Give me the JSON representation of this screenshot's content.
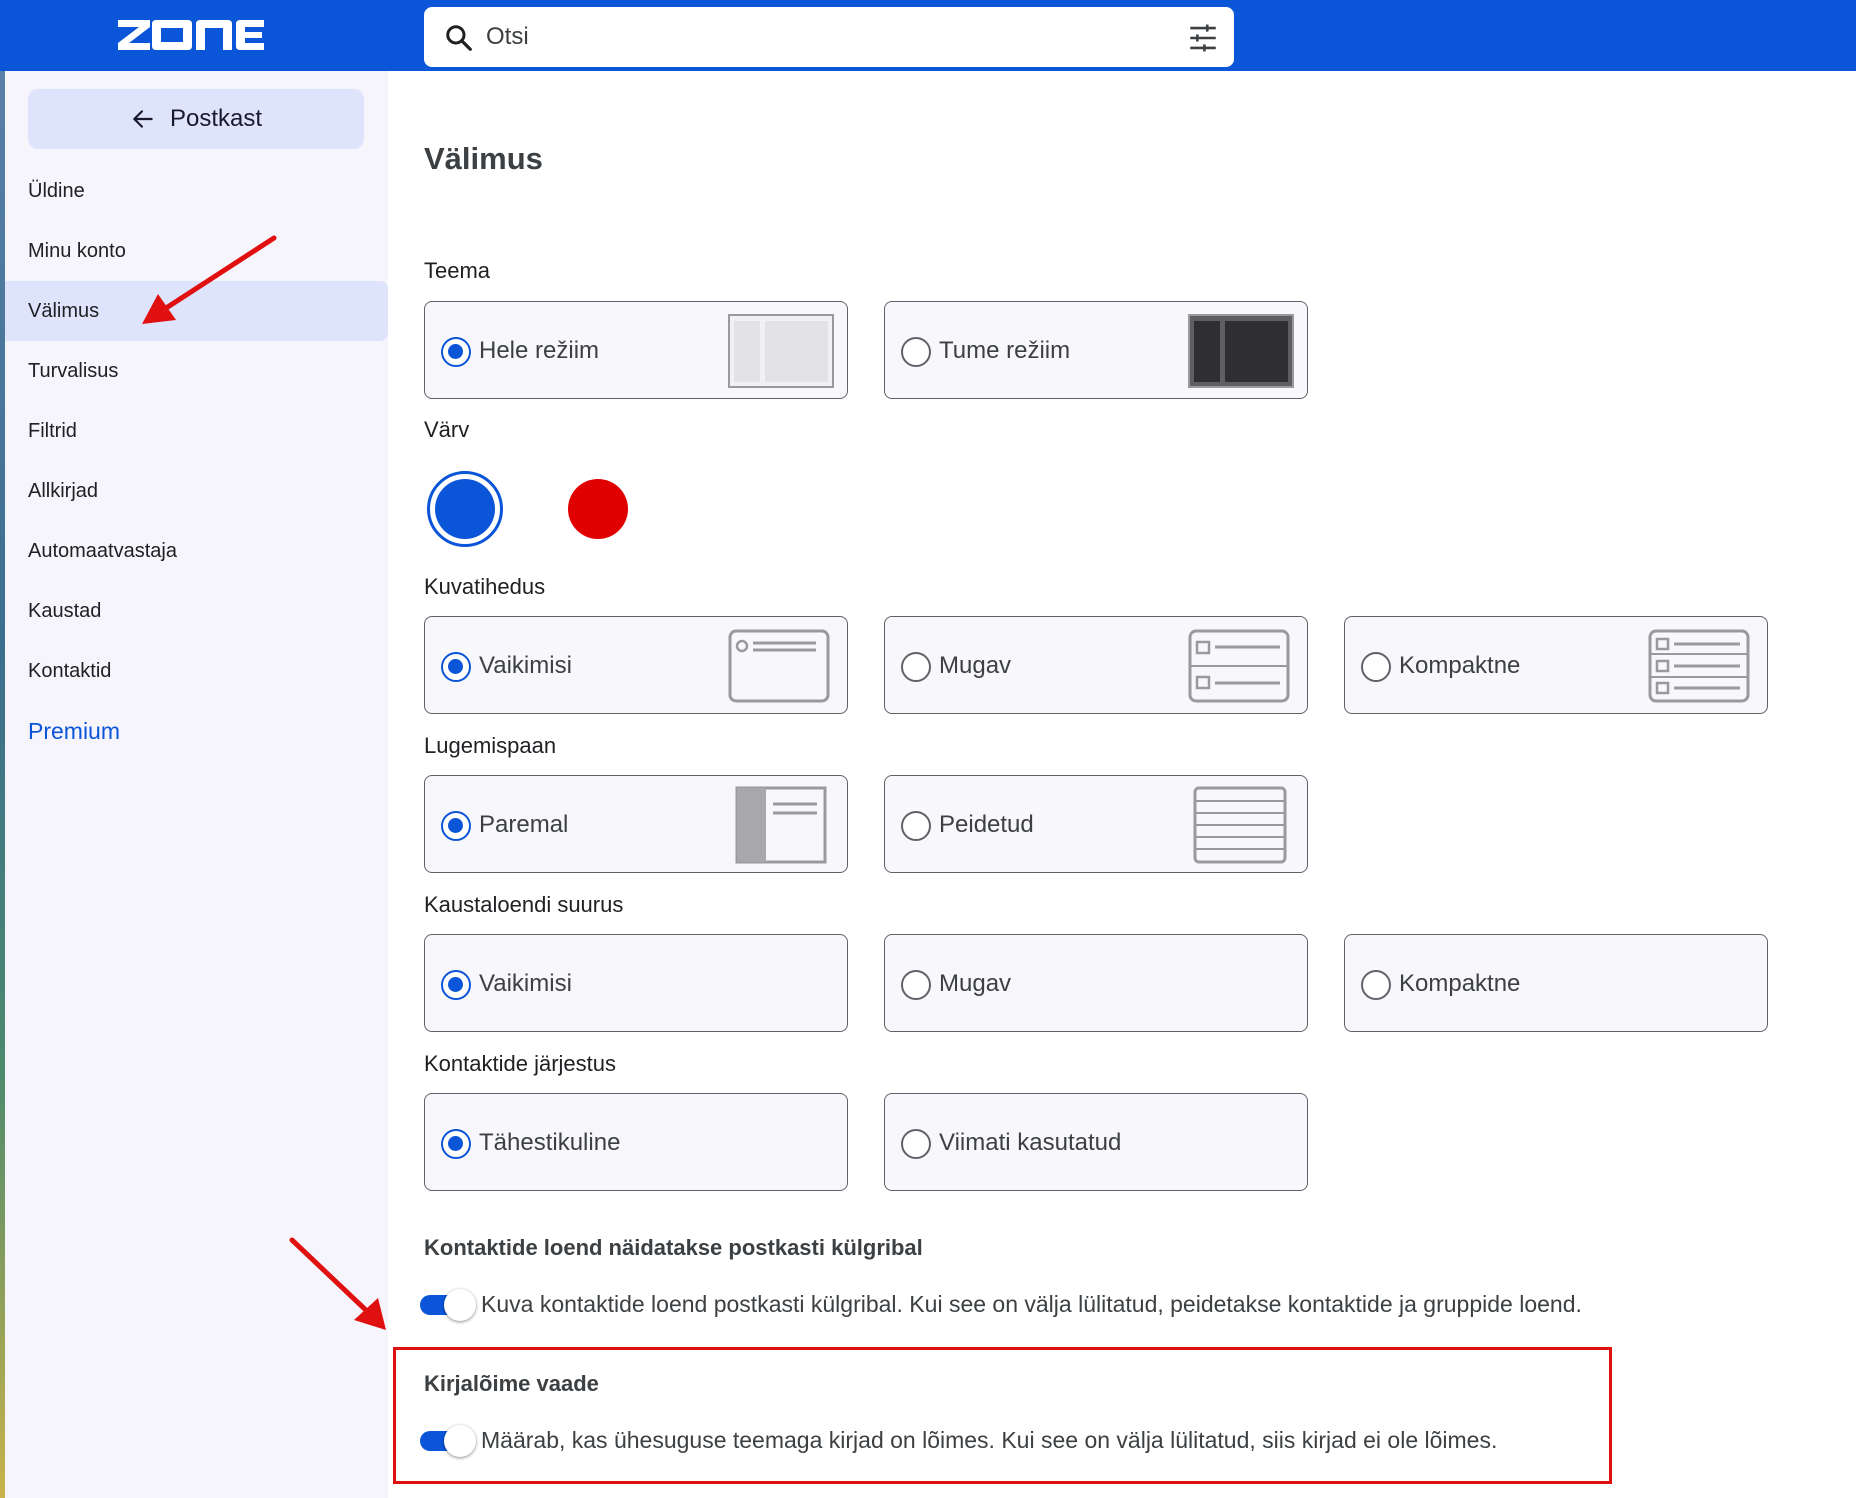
{
  "app": {
    "logo_text": "ZONE",
    "search": {
      "placeholder": "Otsi"
    }
  },
  "sidebar": {
    "back_label": "Postkast",
    "items": [
      {
        "label": "Üldine"
      },
      {
        "label": "Minu konto"
      },
      {
        "label": "Välimus",
        "active": true
      },
      {
        "label": "Turvalisus"
      },
      {
        "label": "Filtrid"
      },
      {
        "label": "Allkirjad"
      },
      {
        "label": "Automaatvastaja"
      },
      {
        "label": "Kaustad"
      },
      {
        "label": "Kontaktid"
      },
      {
        "label": "Premium"
      }
    ]
  },
  "main": {
    "title": "Välimus",
    "theme": {
      "label": "Teema",
      "options": [
        {
          "label": "Hele režiim",
          "checked": true
        },
        {
          "label": "Tume režiim",
          "checked": false
        }
      ]
    },
    "color": {
      "label": "Värv",
      "swatches": [
        {
          "color": "#0b55d8",
          "selected": true
        },
        {
          "color": "#e00000",
          "selected": false
        }
      ]
    },
    "density": {
      "label": "Kuvatihedus",
      "options": [
        {
          "label": "Vaikimisi",
          "checked": true
        },
        {
          "label": "Mugav",
          "checked": false
        },
        {
          "label": "Kompaktne",
          "checked": false
        }
      ]
    },
    "reading_pane": {
      "label": "Lugemispaan",
      "options": [
        {
          "label": "Paremal",
          "checked": true
        },
        {
          "label": "Peidetud",
          "checked": false
        }
      ]
    },
    "folder_size": {
      "label": "Kaustaloendi suurus",
      "options": [
        {
          "label": "Vaikimisi",
          "checked": true
        },
        {
          "label": "Mugav",
          "checked": false
        },
        {
          "label": "Kompaktne",
          "checked": false
        }
      ]
    },
    "contact_order": {
      "label": "Kontaktide järjestus",
      "options": [
        {
          "label": "Tähestikuline",
          "checked": true
        },
        {
          "label": "Viimati kasutatud",
          "checked": false
        }
      ]
    },
    "contacts_sidebar": {
      "label": "Kontaktide loend näidatakse postkasti külgribal",
      "toggle_on": true,
      "description": "Kuva kontaktide loend postkasti külgribal. Kui see on välja lülitatud, peidetakse kontaktide ja gruppide loend."
    },
    "threading": {
      "label": "Kirjalõime vaade",
      "toggle_on": true,
      "description": "Määrab, kas ühesuguse teemaga kirjad on lõimes. Kui see on välja lülitatud, siis kirjad ei ole lõimes."
    }
  },
  "colors": {
    "brand_blue": "#0b55d8",
    "annotation_red": "#e01010",
    "sidebar_bg": "#f6f5fb",
    "active_bg": "#dde4fb"
  }
}
